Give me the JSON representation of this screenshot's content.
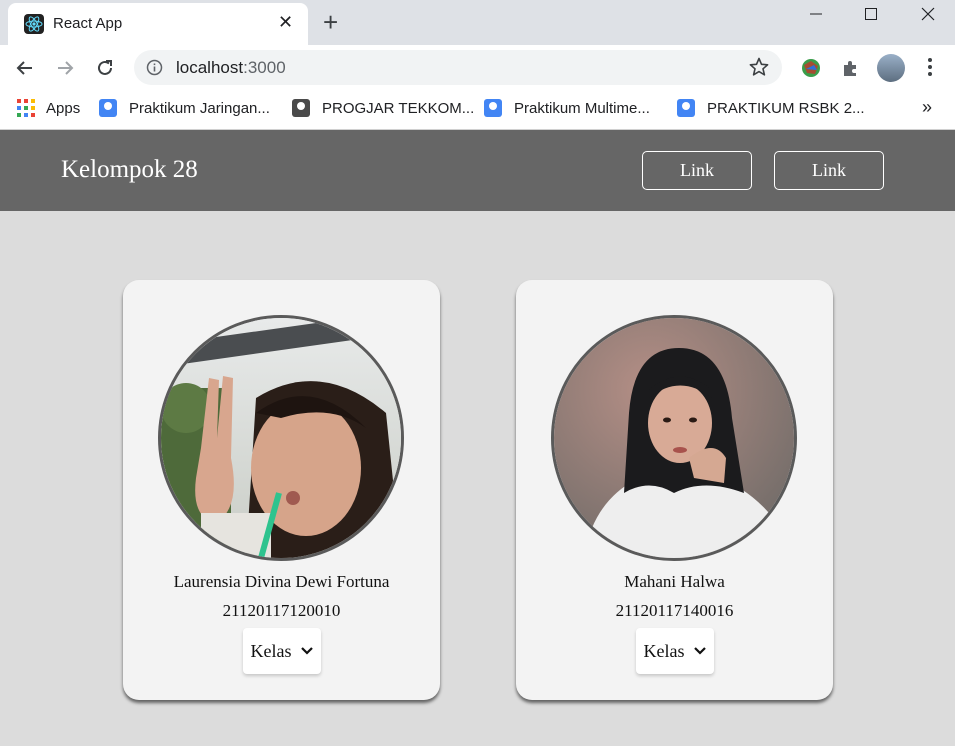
{
  "browser": {
    "tab_title": "React App",
    "url_host": "localhost",
    "url_port": ":3000",
    "bookmarks": [
      {
        "label": "Apps"
      },
      {
        "label": "Praktikum Jaringan..."
      },
      {
        "label": "PROGJAR TEKKOM..."
      },
      {
        "label": "Praktikum Multime..."
      },
      {
        "label": "PRAKTIKUM RSBK 2..."
      }
    ],
    "more_bookmarks": "»"
  },
  "navbar": {
    "brand": "Kelompok 28",
    "links": [
      {
        "label": "Link"
      },
      {
        "label": "Link"
      }
    ],
    "background": "#666666"
  },
  "cards": [
    {
      "name": "Laurensia Divina Dewi Fortuna",
      "nim": "21120117120010",
      "select_label": "Kelas"
    },
    {
      "name": "Mahani Halwa",
      "nim": "21120117140016",
      "select_label": "Kelas"
    }
  ],
  "colors": {
    "page_background": "#dcdcdc",
    "card_background": "#f3f3f3"
  }
}
